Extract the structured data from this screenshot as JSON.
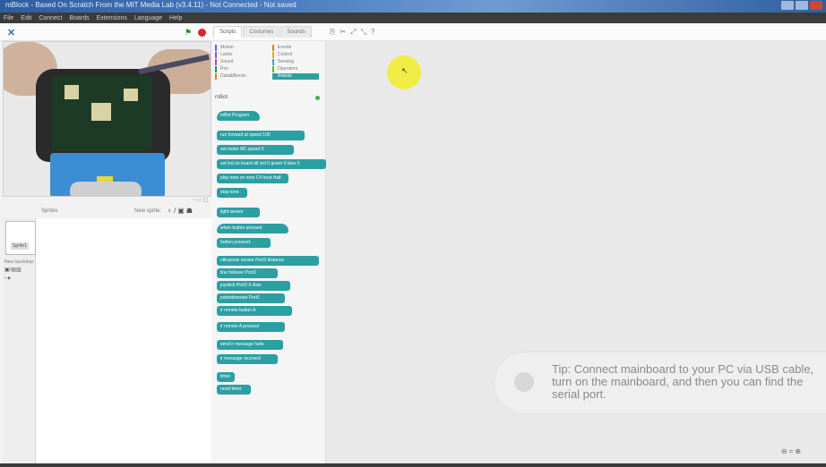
{
  "window": {
    "title": "mBlock - Based On Scratch From the MIT Media Lab (v3.4.11) - Not Connected - Not saved"
  },
  "menu": [
    "File",
    "Edit",
    "Connect",
    "Boards",
    "Extensions",
    "Language",
    "Help"
  ],
  "toolbar": {
    "tabs": [
      "Scripts",
      "Costumes",
      "Sounds"
    ],
    "active_tab": "Scripts",
    "tool_icons": [
      "duplicate-icon",
      "delete-icon",
      "grow-icon",
      "shrink-icon",
      "help-icon"
    ]
  },
  "sprites": {
    "header_label": "Sprites",
    "new_sprite_label": "New sprite:",
    "sprite_name": "Sprite1",
    "backdrop_label": "New backdrop:"
  },
  "palette": {
    "categories": [
      {
        "name": "Motion",
        "color": "#4a6cd4"
      },
      {
        "name": "Looks",
        "color": "#8a55d7"
      },
      {
        "name": "Sound",
        "color": "#bb42c3"
      },
      {
        "name": "Pen",
        "color": "#0e9a6c"
      },
      {
        "name": "Data&Blocks",
        "color": "#ee7d16"
      },
      {
        "name": "Events",
        "color": "#c88330"
      },
      {
        "name": "Control",
        "color": "#e1a91a"
      },
      {
        "name": "Sensing",
        "color": "#2ca5e2"
      },
      {
        "name": "Operators",
        "color": "#5cb712"
      },
      {
        "name": "Robots",
        "color": "#2f9f9e"
      }
    ],
    "selected_category": "Robots",
    "section_label": "mBot",
    "blocks": [
      "mBot Program",
      "run forward at speed 100",
      "set motor M1 speed 0",
      "set led on board all red 0 green 0 blue 0",
      "play tone on note C4 beat Half",
      "stop tone",
      "light sensor",
      "when button pressed",
      "button pressed",
      "ultrasonic sensor Port3 distance",
      "line follower Port2",
      "joystick Port3 X-Axis",
      "potentiometer Port1",
      "ir remote button A",
      "ir remote A pressed",
      "send ir message hello",
      "ir message received",
      "timer",
      "reset timer"
    ]
  },
  "scripts_area": {
    "tip_text": "Tip: Connect mainboard to your PC via USB cable, turn on the mainboard, and then you can find the serial port."
  },
  "colors": {
    "robots_block": "#2c9fa3",
    "stage_bg": "#e9e9e9",
    "stop_button": "#d8262a",
    "cursor_highlight": "#f2ec28"
  }
}
